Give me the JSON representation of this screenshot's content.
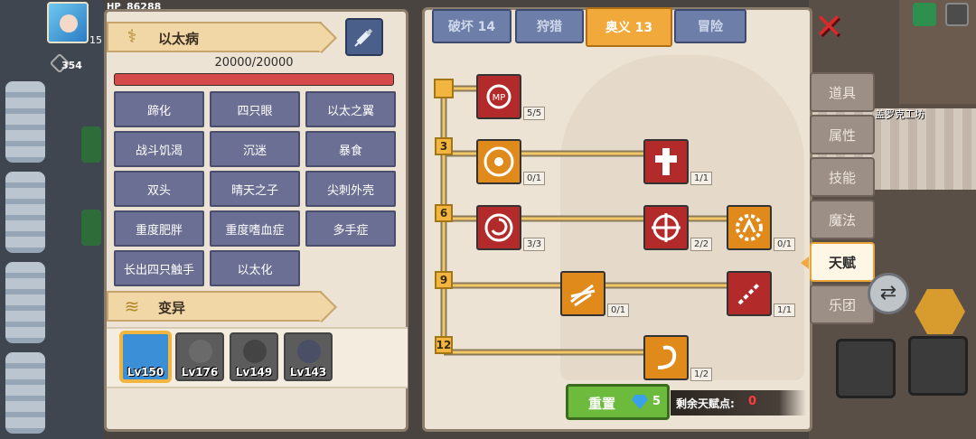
{
  "hud": {
    "hp_tag": "HP",
    "hp_value": "86288",
    "hero_level": "15",
    "gear_count": "354",
    "workshop_label": "盖罗克工坊"
  },
  "disease": {
    "title": "以太病",
    "hp_text": "20000/20000",
    "hp_fraction": 1.0,
    "traits": [
      "蹄化",
      "四只眼",
      "以太之翼",
      "战斗饥渴",
      "沉迷",
      "暴食",
      "双头",
      "晴天之子",
      "尖刺外壳",
      "重度肥胖",
      "重度嗜血症",
      "多手症",
      "长出四只触手",
      "以太化"
    ]
  },
  "mutation": {
    "title": "变异",
    "pets": [
      {
        "level": "Lv150",
        "selected": true,
        "color": "#3a8fd6"
      },
      {
        "level": "Lv176",
        "selected": false,
        "color": "#6a6a6a"
      },
      {
        "level": "Lv149",
        "selected": false,
        "color": "#444444"
      },
      {
        "level": "Lv143",
        "selected": false,
        "color": "#4b4f66"
      }
    ]
  },
  "tabs": [
    {
      "label": "破坏 14",
      "active": false
    },
    {
      "label": "狩猎",
      "active": false
    },
    {
      "label": "奥义 13",
      "active": true
    },
    {
      "label": "冒险",
      "active": false
    }
  ],
  "side_tabs": [
    {
      "label": "道具",
      "active": false
    },
    {
      "label": "属性",
      "active": false
    },
    {
      "label": "技能",
      "active": false
    },
    {
      "label": "魔法",
      "active": false
    },
    {
      "label": "天赋",
      "active": true
    },
    {
      "label": "乐团",
      "active": false
    }
  ],
  "talent_tree": {
    "tiers": [
      "3",
      "6",
      "9",
      "12"
    ],
    "nodes": [
      {
        "name": "mp-node",
        "count": "5/5",
        "color": "red"
      },
      {
        "name": "vortex-node",
        "count": "0/1",
        "color": "orange"
      },
      {
        "name": "holy-hand-node",
        "count": "1/1",
        "color": "red"
      },
      {
        "name": "spiral-node",
        "count": "3/3",
        "color": "red"
      },
      {
        "name": "cross-target-node",
        "count": "2/2",
        "color": "red"
      },
      {
        "name": "gear-shield-node",
        "count": "0/1",
        "color": "orange"
      },
      {
        "name": "lightning-node",
        "count": "0/1",
        "color": "orange"
      },
      {
        "name": "chain-break-node",
        "count": "1/1",
        "color": "red"
      },
      {
        "name": "cyclone-node",
        "count": "1/2",
        "color": "orange"
      }
    ]
  },
  "footer": {
    "reset_label": "重置",
    "gem_cost": "5",
    "remaining_label": "剩余天赋点:",
    "remaining_value": "0"
  },
  "colors": {
    "accent": "#f2a93b",
    "hp_red": "#d64a4a",
    "trait_bg": "#6b6f93",
    "reset_green": "#6cbb3c"
  }
}
